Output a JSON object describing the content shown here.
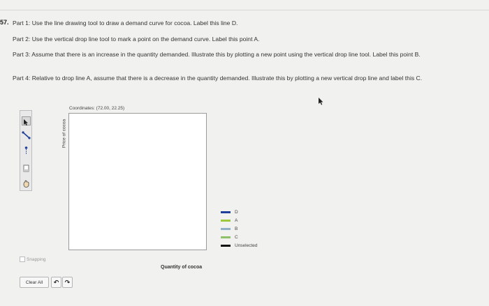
{
  "question": {
    "number": "57.",
    "part1": "Part 1: Use the line drawing tool to draw a demand curve for cocoa. Label this line D.",
    "part2": "Part 2: Use the vertical drop line tool to mark a point on the demand curve. Label this point A.",
    "part3": "Part 3: Assume that there is an increase in the quantity demanded. Illustrate this by plotting a new point using the vertical drop line tool. Label this point B.",
    "part4": "Part 4: Relative to drop line A, assume that there is a decrease in the quantity demanded. Illustrate this by plotting a new vertical drop line and label this C."
  },
  "graph": {
    "coordinates": "Coordinates: (72.00, 22.25)",
    "y_label": "Price of cocoa",
    "x_label": "Quantity of cocoa"
  },
  "legend": [
    {
      "label": "D",
      "color": "#1f3f9a"
    },
    {
      "label": "A",
      "color": "#9ec93c"
    },
    {
      "label": "B",
      "color": "#8fb0c8"
    },
    {
      "label": "C",
      "color": "#8fc06a"
    },
    {
      "label": "Unselected",
      "color": "#111111"
    }
  ],
  "controls": {
    "snapping": "Snapping",
    "clear_all": "Clear All",
    "undo": "↶",
    "redo": "↷"
  },
  "tools": [
    "pointer-tool",
    "line-tool",
    "drop-line-tool",
    "eraser-tool",
    "hand-tool"
  ]
}
